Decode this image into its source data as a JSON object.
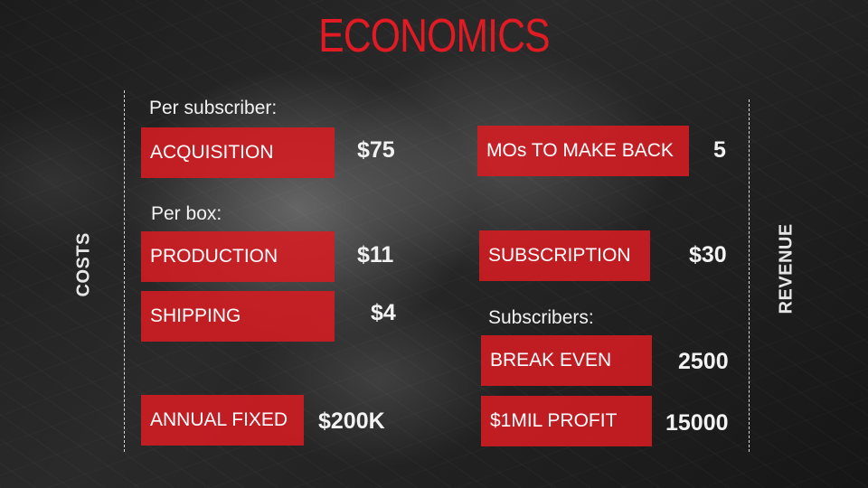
{
  "slide": {
    "title": "ECONOMICS",
    "costs_label": "COSTS",
    "revenue_label": "REVENUE",
    "colors": {
      "accent": "#e01b24",
      "box": "#d61c23",
      "text": "#f2f2f2"
    }
  },
  "costs": {
    "per_subscriber_heading": "Per subscriber:",
    "acquisition": {
      "label": "ACQUISITION",
      "value": "$75"
    },
    "per_box_heading": "Per box:",
    "production": {
      "label": "PRODUCTION",
      "value": "$11"
    },
    "shipping": {
      "label": "SHIPPING",
      "value": "$4"
    },
    "annual_fixed": {
      "label": "ANNUAL FIXED",
      "value": "$200K"
    }
  },
  "revenue": {
    "months_to_make_back": {
      "label": "MOs TO MAKE BACK",
      "value": "5"
    },
    "subscription": {
      "label": "SUBSCRIPTION",
      "value": "$30"
    },
    "subscribers_heading": "Subscribers:",
    "break_even": {
      "label": "BREAK EVEN",
      "value": "2500"
    },
    "profit": {
      "label": "$1MIL PROFIT",
      "value": "15000"
    }
  }
}
